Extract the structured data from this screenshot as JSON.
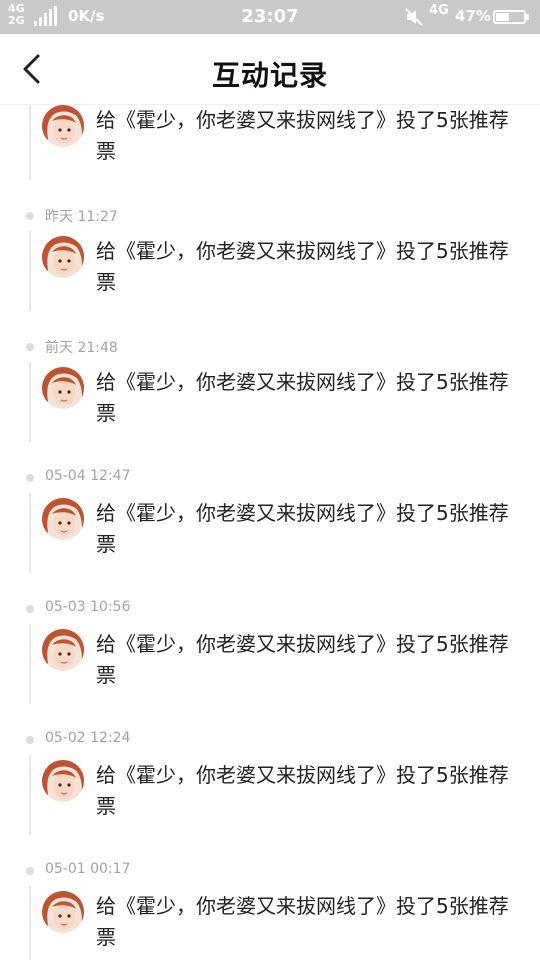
{
  "status_bar": {
    "net_top": "4G",
    "net_bottom": "2G",
    "speed": "0K/s",
    "time": "23:07",
    "network": "4G",
    "battery": "47%",
    "icons": [
      "signal-icon",
      "mute-icon",
      "battery-icon"
    ]
  },
  "header": {
    "title": "互动记录",
    "back_icon": "chevron-left-icon"
  },
  "records": [
    {
      "time": "",
      "text": "给《霍少，你老婆又来拔网线了》投了5张推荐票"
    },
    {
      "time": "昨天 11:27",
      "text": "给《霍少，你老婆又来拔网线了》投了5张推荐票"
    },
    {
      "time": "前天 21:48",
      "text": "给《霍少，你老婆又来拔网线了》投了5张推荐票"
    },
    {
      "time": "05-04 12:47",
      "text": "给《霍少，你老婆又来拔网线了》投了5张推荐票"
    },
    {
      "time": "05-03 10:56",
      "text": "给《霍少，你老婆又来拔网线了》投了5张推荐票"
    },
    {
      "time": "05-02 12:24",
      "text": "给《霍少，你老婆又来拔网线了》投了5张推荐票"
    },
    {
      "time": "05-01 00:17",
      "text": "给《霍少，你老婆又来拔网线了》投了5张推荐票"
    }
  ],
  "colors": {
    "status_bar_bg": "#c9c9c9",
    "timeline": "#e6e6e6",
    "time_text": "#a3a3a3",
    "avatar_hair": "#c0522f"
  }
}
